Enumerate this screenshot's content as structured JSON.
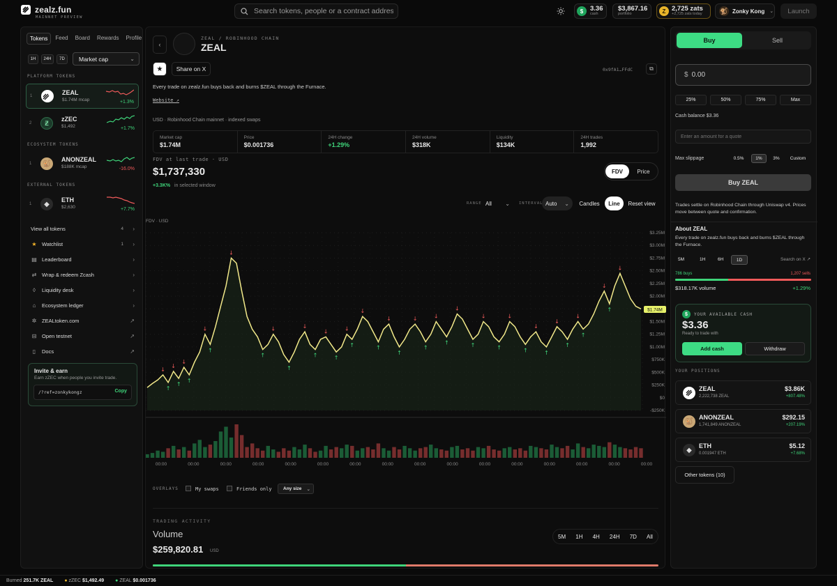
{
  "brand": {
    "name": "zealz.fun",
    "tagline": "MAINNET PREVIEW"
  },
  "search": {
    "placeholder": "Search tokens, people or a contract address"
  },
  "header": {
    "cash_value": "3.36",
    "cash_label": "cash",
    "portfolio_value": "$3,867.16",
    "portfolio_label": "portfolio",
    "zats_value": "2,725 zats",
    "zats_label": "+2,725 zats today",
    "user_name": "Zonky Kong",
    "launch_label": "Launch"
  },
  "sidebar": {
    "tabs": [
      "Tokens",
      "Feed",
      "Board",
      "Rewards",
      "Profile"
    ],
    "timeframes": [
      "1H",
      "24H",
      "7D"
    ],
    "sort": "Market cap",
    "platform_heading": "PLATFORM TOKENS",
    "ecosystem_heading": "ECOSYSTEM TOKENS",
    "external_heading": "EXTERNAL TOKENS",
    "tokens": [
      {
        "rank": "1",
        "name": "ZEAL",
        "mcap": "$1.74M mcap",
        "change": "+1.3%"
      },
      {
        "rank": "2",
        "name": "zZEC",
        "mcap": "$1,492",
        "change": "+1.7%"
      },
      {
        "rank": "1",
        "name": "ANONZEAL",
        "mcap": "$188K mcap",
        "change": "-16.0%"
      },
      {
        "rank": "1",
        "name": "ETH",
        "mcap": "$2,630",
        "change": "+7.7%"
      }
    ],
    "nav": [
      {
        "label": "View all tokens",
        "count": "4"
      },
      {
        "label": "Watchlist",
        "count": "1"
      },
      {
        "label": "Leaderboard",
        "count": ""
      },
      {
        "label": "Wrap & redeem Zcash",
        "count": ""
      },
      {
        "label": "Liquidity desk",
        "count": ""
      },
      {
        "label": "Ecosystem ledger",
        "count": ""
      },
      {
        "label": "ZEALtoken.com",
        "count": ""
      },
      {
        "label": "Open testnet",
        "count": ""
      },
      {
        "label": "Docs",
        "count": ""
      }
    ],
    "invite": {
      "title": "Invite & earn",
      "subtitle": "Earn zZEC when people you invite trade.",
      "link": "/?ref=zonkykongz",
      "copy": "Copy"
    }
  },
  "token": {
    "chain_label": "ZEAL / ROBINHOOD CHAIN",
    "name": "ZEAL",
    "share_label": "Share on X",
    "address": "0x9fA1…FFdC",
    "description": "Every trade on zealz.fun buys back and burns $ZEAL through the Furnace.",
    "website": "Website ↗",
    "source_line": "USD · Robinhood Chain mainnet · indexed swaps"
  },
  "stats": [
    {
      "label": "Market cap",
      "value": "$1.74M"
    },
    {
      "label": "Price",
      "value": "$0.001736"
    },
    {
      "label": "24H change",
      "value": "+1.29%"
    },
    {
      "label": "24H volume",
      "value": "$318K"
    },
    {
      "label": "Liquidity",
      "value": "$134K"
    },
    {
      "label": "24H trades",
      "value": "1,992"
    }
  ],
  "fdv": {
    "label": "FDV at last trade · USD",
    "value": "$1,737,330",
    "change": "+3.3K%",
    "window": "in selected window"
  },
  "chart_toggle": [
    "FDV",
    "Price"
  ],
  "controls": {
    "range_label": "RANGE",
    "range_value": "All",
    "interval_label": "INTERVAL",
    "interval_value": "Auto",
    "candles": "Candles",
    "line": "Line",
    "reset": "Reset view"
  },
  "chart_data": {
    "type": "line",
    "title": "",
    "ylabel": "FDV · USD",
    "xlabel": "",
    "ylim": [
      -250000,
      3250000
    ],
    "y_ticks": [
      "$3.25M",
      "$3.00M",
      "$2.75M",
      "$2.50M",
      "$2.25M",
      "$2.00M",
      "$1.75M",
      "$1.50M",
      "$1.25M",
      "$1.00M",
      "$750K",
      "$500K",
      "$250K",
      "$0",
      "-$250K"
    ],
    "y_tick_values": [
      3250000,
      3000000,
      2750000,
      2500000,
      2250000,
      2000000,
      1750000,
      1500000,
      1250000,
      1000000,
      750000,
      500000,
      250000,
      0,
      -250000
    ],
    "last_value_label": "$1.74M",
    "last_value": 1740000,
    "x_tick_labels": [
      "00:00",
      "00:00",
      "00:00",
      "00:00",
      "00:00",
      "00:00",
      "00:00",
      "00:00",
      "00:00",
      "00:00",
      "00:00",
      "00:00",
      "00:00",
      "00:00",
      "00:00",
      "00:00"
    ],
    "values": [
      200000,
      280000,
      350000,
      450000,
      300000,
      520000,
      380000,
      600000,
      450000,
      700000,
      900000,
      1250000,
      1050000,
      1400000,
      1800000,
      2200000,
      2750000,
      2650000,
      2100000,
      1600000,
      1350000,
      1200000,
      950000,
      1050000,
      1250000,
      1100000,
      850000,
      700000,
      900000,
      1150000,
      1300000,
      1050000,
      950000,
      1150000,
      1200000,
      1050000,
      900000,
      1000000,
      1250000,
      1150000,
      1350000,
      1600000,
      1500000,
      1300000,
      1100000,
      1350000,
      1450000,
      1200000,
      1000000,
      1150000,
      1350000,
      1450000,
      1300000,
      1100000,
      1250000,
      1500000,
      1350000,
      1200000,
      1400000,
      1650000,
      1550000,
      1350000,
      1150000,
      1250000,
      1500000,
      1400000,
      1200000,
      1100000,
      1250000,
      1500000,
      1400000,
      1200000,
      1050000,
      1200000,
      1300000,
      1100000,
      1000000,
      1200000,
      1400000,
      1300000,
      1150000,
      1350000,
      1500000,
      1350000,
      1450000,
      1650000,
      1900000,
      2100000,
      1850000,
      2200000,
      2450000,
      2200000,
      1950000,
      1800000,
      1750000
    ],
    "volume": [
      3,
      4,
      6,
      5,
      8,
      10,
      7,
      9,
      6,
      12,
      15,
      9,
      11,
      14,
      22,
      26,
      17,
      28,
      19,
      9,
      12,
      8,
      6,
      10,
      7,
      5,
      8,
      6,
      9,
      7,
      11,
      8,
      5,
      6,
      10,
      7,
      9,
      8,
      11,
      10,
      6,
      8,
      9,
      7,
      12,
      8,
      6,
      9,
      7,
      10,
      8,
      6,
      8,
      9,
      11,
      8,
      7,
      6,
      9,
      10,
      7,
      8,
      6,
      9,
      8,
      10,
      7,
      6,
      8,
      9,
      7,
      8,
      6,
      10,
      9,
      8,
      7,
      11,
      9,
      8,
      10,
      7,
      12,
      9,
      8,
      11,
      10,
      9,
      13,
      11,
      9,
      8,
      7,
      9,
      8
    ]
  },
  "overlays": {
    "label": "OVERLAYS",
    "my_swaps": "My swaps",
    "friends_only": "Friends only",
    "size": "Any size"
  },
  "activity": {
    "label": "TRADING ACTIVITY",
    "title": "Volume",
    "value": "$259,820.81",
    "unit": "USD",
    "ranges": [
      "5M",
      "1H",
      "4H",
      "24H",
      "7D",
      "All"
    ],
    "buy_fraction": 0.5
  },
  "trade": {
    "buy_tab": "Buy",
    "sell_tab": "Sell",
    "amount": "0.00",
    "amount_symbol": "$",
    "pcts": [
      "25%",
      "50%",
      "75%",
      "Max"
    ],
    "cash_balance": "Cash balance $3.36",
    "quote_placeholder": "Enter an amount for a quote",
    "slippage_label": "Max slippage",
    "slippage_options": [
      "0.5%",
      "1%",
      "3%",
      "Custom"
    ],
    "buy_button": "Buy ZEAL",
    "note": "Trades settle on Robinhood Chain through Uniswap v4. Prices move between quote and confirmation."
  },
  "about": {
    "title": "About ZEAL",
    "text": "Every trade on zealz.fun buys back and burns $ZEAL through the Furnace.",
    "ranges": [
      "5M",
      "1H",
      "6H",
      "1D"
    ],
    "search_on_x": "Search on X ↗",
    "buys": "786 buys",
    "sells": "1,207 sells",
    "buy_fraction": 0.39,
    "volume": "$318.17K volume",
    "change": "+1.29%"
  },
  "cash_card": {
    "label": "YOUR AVAILABLE CASH",
    "value": "$3.36",
    "sub": "Ready to trade with",
    "add": "Add cash",
    "withdraw": "Withdraw"
  },
  "positions": {
    "heading": "YOUR POSITIONS",
    "items": [
      {
        "name": "ZEAL",
        "qty": "2,222,738 ZEAL",
        "value": "$3.86K",
        "change": "+807.48%"
      },
      {
        "name": "ANONZEAL",
        "qty": "1,741,849 ANONZEAL",
        "value": "$292.15",
        "change": "+207.19%"
      },
      {
        "name": "ETH",
        "qty": "0.001947 ETH",
        "value": "$5.12",
        "change": "+7.68%"
      }
    ],
    "other": "Other tokens (10)"
  },
  "footer": {
    "burned_label": "Burned",
    "burned_value": "251.7K ZEAL",
    "zzec_label": "zZEC",
    "zzec_value": "$1,492.49",
    "zeal_label": "ZEAL",
    "zeal_value": "$0.001736"
  },
  "colors": {
    "accent": "#3ddc84",
    "up": "#3fd47a",
    "down": "#ef5a5a",
    "line": "#f2e98a",
    "background": "#0a0a0a"
  }
}
